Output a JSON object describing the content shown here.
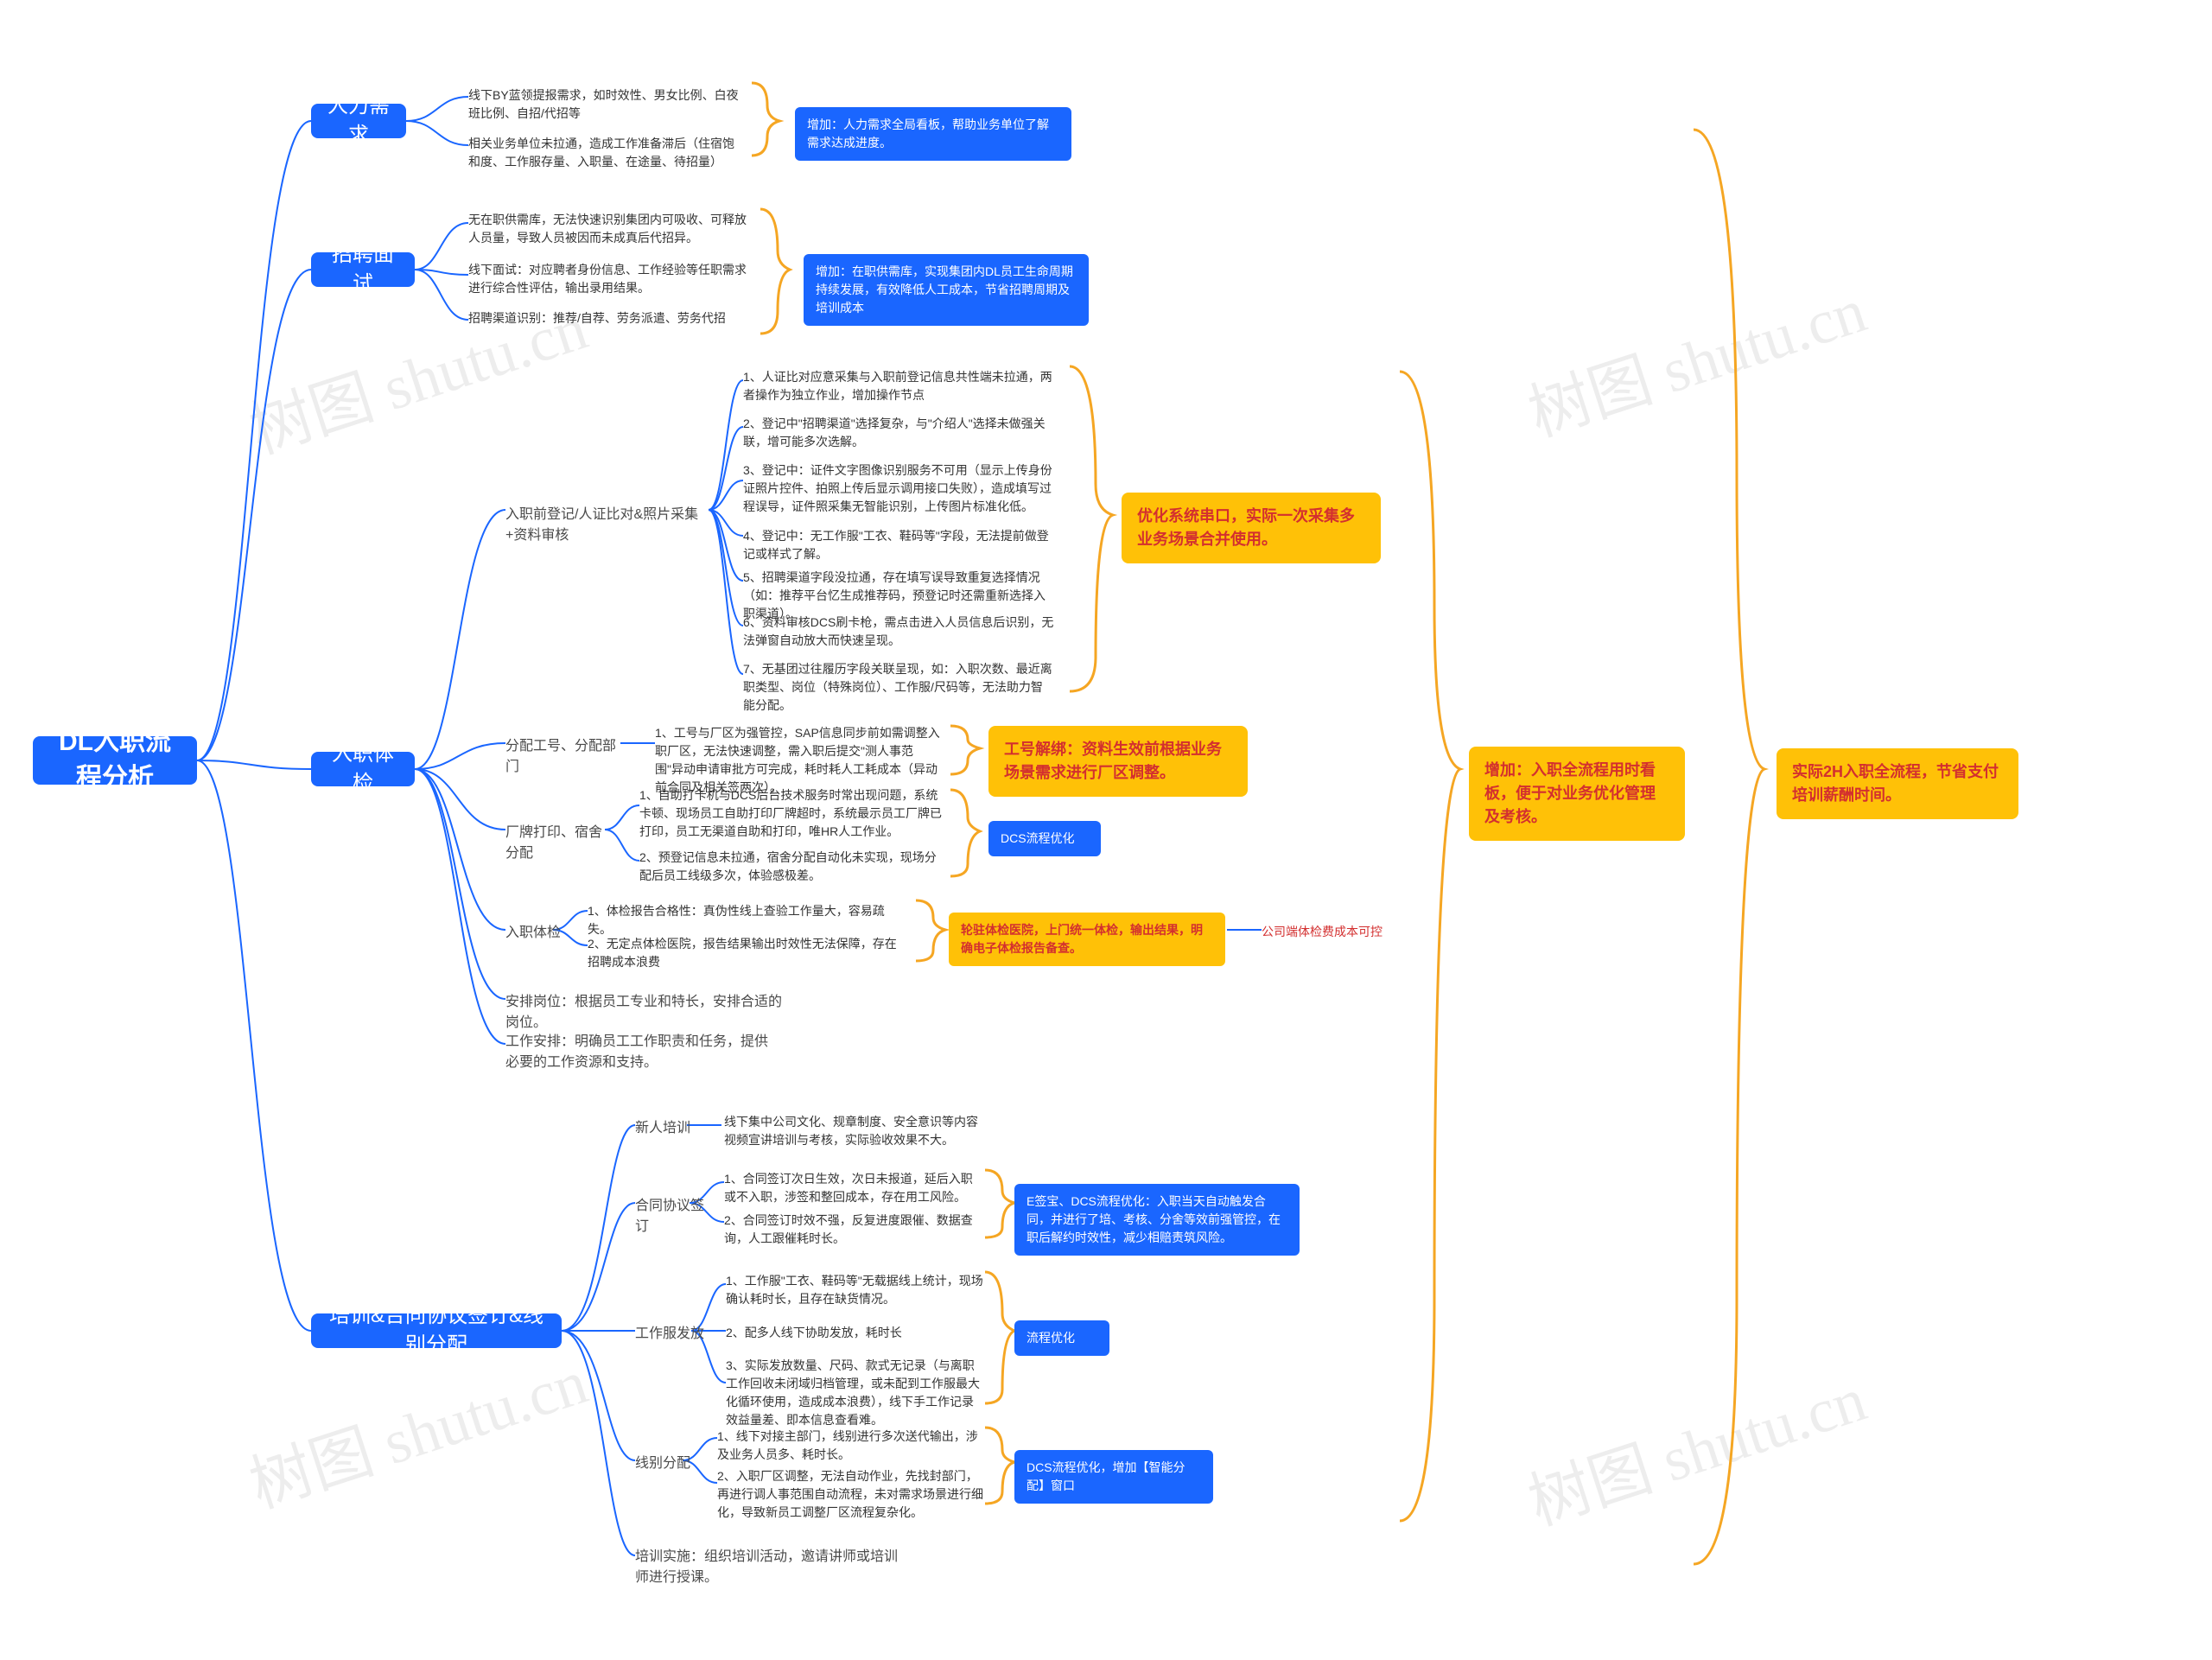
{
  "watermark": "树图 shutu.cn",
  "root": {
    "label": "DL入职流程分析"
  },
  "branches": {
    "b1": {
      "label": "人力需求",
      "leaf1": "线下BY蓝领提报需求，如时效性、男女比例、白夜班比例、自招/代招等",
      "leaf2": "相关业务单位未拉通，造成工作准备滞后（住宿饱和度、工作服存量、入职量、在途量、待招量）",
      "callout": "增加：人力需求全局看板，帮助业务单位了解需求达成进度。"
    },
    "b2": {
      "label": "招聘面试",
      "leaf1": "无在职供需库，无法快速识别集团内可吸收、可释放人员量，导致人员被因而未成真后代招异。",
      "leaf2": "线下面试：对应聘者身份信息、工作经验等任职需求进行综合性评估，输出录用结果。",
      "leaf3": "招聘渠道识别：推荐/自荐、劳务派遣、劳务代招",
      "callout": "增加：在职供需库，实现集团内DL员工生命周期持续发展，有效降低人工成本，节省招聘周期及培训成本"
    },
    "b3": {
      "label": "入职体检",
      "sec1": {
        "title": "入职前登记/人证比对&照片采集+资料审核",
        "l1": "1、人证比对应意采集与入职前登记信息共性端未拉通，两者操作为独立作业，增加操作节点",
        "l2": "2、登记中\"招聘渠道\"选择复杂，与\"介绍人\"选择未做强关联，增可能多次选解。",
        "l3": "3、登记中：证件文字图像识别服务不可用（显示上传身份证照片控件、拍照上传后显示调用接口失败），造成填写过程误导，证件照采集无智能识别，上传图片标准化低。",
        "l4": "4、登记中：无工作服\"工衣、鞋码等\"字段，无法提前做登记或样式了解。",
        "l5": "5、招聘渠道字段没拉通，存在填写误导致重复选择情况（如：推荐平台忆生成推荐码，预登记时还需重新选择入职渠道）。",
        "l6": "6、资料审核DCS刷卡枪，需点击进入人员信息后识别，无法弹窗自动放大而快速呈现。",
        "l7": "7、无基团过往履历字段关联呈现，如：入职次数、最近离职类型、岗位（特殊岗位）、工作服/尺码等，无法助力智能分配。",
        "callout": "优化系统串口，实际一次采集多业务场景合并使用。"
      },
      "sec2": {
        "title": "分配工号、分配部门",
        "l1": "1、工号与厂区为强管控，SAP信息同步前如需调整入职厂区，无法快速调整，需入职后提交\"测人事范围\"异动申请审批方可完成，耗时耗人工耗成本（异动前合同及相关签两次）。",
        "callout": "工号解绑：资料生效前根据业务场景需求进行厂区调整。"
      },
      "sec3": {
        "title": "厂牌打印、宿舍分配",
        "l1": "1、自助打卡机与DCS后台技术服务时常出现问题，系统卡顿、现场员工自助打印厂牌超时，系统最示员工厂牌已打印，员工无渠道自助和打印，唯HR人工作业。",
        "l2": "2、预登记信息未拉通，宿舍分配自动化未实现，现场分配后员工线级多次，体验感极差。",
        "callout": "DCS流程优化"
      },
      "sec4": {
        "title": "入职体检",
        "l1": "1、体检报告合格性：真伪性线上查验工作量大，容易疏失。",
        "l2": "2、无定点体检医院，报告结果输出时效性无法保障，存在招聘成本浪费",
        "callout": "轮驻体检医院，上门统一体检，输出结果，明确电子体检报告备查。",
        "note": "公司端体检费成本可控"
      },
      "sec5": {
        "title": "安排岗位：根据员工专业和特长，安排合适的岗位。"
      },
      "sec6": {
        "title": "工作安排：明确员工工作职责和任务，提供必要的工作资源和支持。"
      }
    },
    "b4": {
      "label": "培训&合同协议签订&线别分配",
      "sec1": {
        "title": "新人培训",
        "l1": "线下集中公司文化、规章制度、安全意识等内容视频宣讲培训与考核，实际验收效果不大。"
      },
      "sec2": {
        "title": "合同协议签订",
        "l1": "1、合同签订次日生效，次日未报道，延后入职或不入职，涉签和整回成本，存在用工风险。",
        "l2": "2、合同签订时效不强，反复进度跟催、数据查询，人工跟催耗时长。",
        "callout": "E签宝、DCS流程优化：入职当天自动触发合同，并进行了培、考核、分舍等效前强管控，在职后解约时效性，减少相赔责筑风险。"
      },
      "sec3": {
        "title": "工作服发放",
        "l1": "1、工作服\"工衣、鞋码等\"无载据线上统计，现场确认耗时长，且存在缺货情况。",
        "l2": "2、配多人线下协助发放，耗时长",
        "l3": "3、实际发放数量、尺码、款式无记录（与离职工作回收未闭域归档管理，或未配到工作服最大化循环使用，造成成本浪费），线下手工作记录效益量差、即本信息查看难。",
        "callout": "流程优化"
      },
      "sec4": {
        "title": "线别分配",
        "l1": "1、线下对接主部门，线别进行多次送代输出，涉及业务人员多、耗时长。",
        "l2": "2、入职厂区调整，无法自动作业，先找封部门，再进行调人事范围自动流程，未对需求场景进行细化，导致新员工调整厂区流程复杂化。",
        "callout": "DCS流程优化，增加【智能分配】窗口"
      },
      "sec5": {
        "title": "培训实施：组织培训活动，邀请讲师或培训师进行授课。"
      }
    }
  },
  "right": {
    "callout1": "增加：入职全流程用时看板，便于对业务优化管理及考核。",
    "callout2": "实际2H入职全流程，节省支付培训薪酬时间。"
  }
}
